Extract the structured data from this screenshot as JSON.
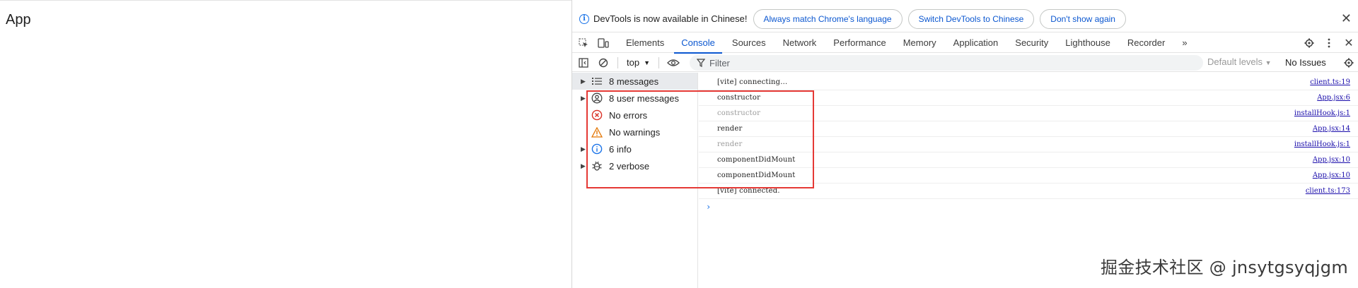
{
  "app": {
    "title": "App"
  },
  "infobar": {
    "message": "DevTools is now available in Chinese!",
    "buttons": [
      "Always match Chrome's language",
      "Switch DevTools to Chinese",
      "Don't show again"
    ]
  },
  "tabs": [
    "Elements",
    "Console",
    "Sources",
    "Network",
    "Performance",
    "Memory",
    "Application",
    "Security",
    "Lighthouse",
    "Recorder"
  ],
  "active_tab": "Console",
  "toolbar": {
    "context": "top",
    "filter_placeholder": "Filter",
    "levels": "Default levels",
    "issues": "No Issues"
  },
  "sidebar": {
    "items": [
      {
        "label": "8 messages",
        "icon": "list-icon"
      },
      {
        "label": "8 user messages",
        "icon": "user-icon"
      },
      {
        "label": "No errors",
        "icon": "error-icon"
      },
      {
        "label": "No warnings",
        "icon": "warning-icon"
      },
      {
        "label": "6 info",
        "icon": "info-icon"
      },
      {
        "label": "2 verbose",
        "icon": "bug-icon"
      }
    ]
  },
  "logs": [
    {
      "message": "[vite] connecting...",
      "source": "client.ts:19",
      "dim": false
    },
    {
      "message": "constructor",
      "source": "App.jsx:6",
      "dim": false
    },
    {
      "message": "constructor",
      "source": "installHook.js:1",
      "dim": true
    },
    {
      "message": "render",
      "source": "App.jsx:14",
      "dim": false
    },
    {
      "message": "render",
      "source": "installHook.js:1",
      "dim": true
    },
    {
      "message": "componentDidMount",
      "source": "App.jsx:10",
      "dim": false
    },
    {
      "message": "componentDidMount",
      "source": "App.jsx:10",
      "dim": false
    },
    {
      "message": "[vite] connected.",
      "source": "client.ts:173",
      "dim": false
    }
  ],
  "watermark": "掘金技术社区 @ jnsytgsyqjgm",
  "colors": {
    "accent": "#0b57d0",
    "highlight": "#e53935",
    "link": "#1a0dab"
  }
}
